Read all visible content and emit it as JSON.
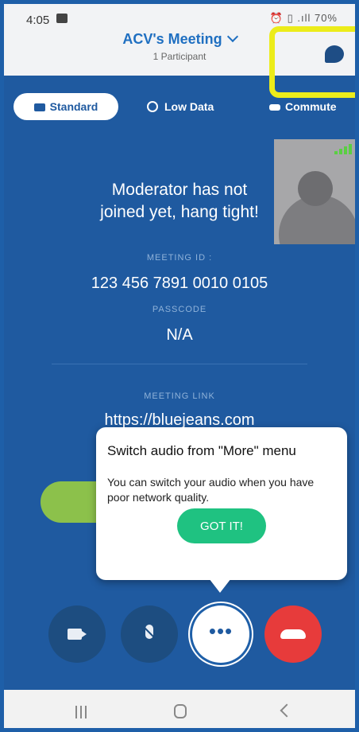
{
  "status_bar": {
    "time": "4:05",
    "right_icons": "⏰ ▯ .ıll 70%"
  },
  "header": {
    "title": "ACV's Meeting",
    "participants": "1 Participant"
  },
  "modes": [
    {
      "label": "Standard",
      "active": true
    },
    {
      "label": "Low Data",
      "active": false
    },
    {
      "label": "Commute",
      "active": false
    }
  ],
  "meeting": {
    "wait_line1": "Moderator has not",
    "wait_line2": "joined yet, hang tight!",
    "id_label": "MEETING ID :",
    "id_value": "123 456 7891 0010 0105",
    "passcode_label": "PASSCODE",
    "passcode_value": "N/A",
    "link_label": "MEETING LINK",
    "link_value": "https://bluejeans.com"
  },
  "tooltip": {
    "title": "Switch audio from \"More\" menu",
    "body": "You can switch your audio when you have poor network quality.",
    "button": "GOT IT!"
  },
  "controls": {
    "more_label": "•••"
  },
  "colors": {
    "accent": "#1f6fc1",
    "background": "#1f5aa0",
    "got_it": "#1fc281",
    "end_call": "#e73b3b",
    "highlight": "#ecec1a"
  }
}
